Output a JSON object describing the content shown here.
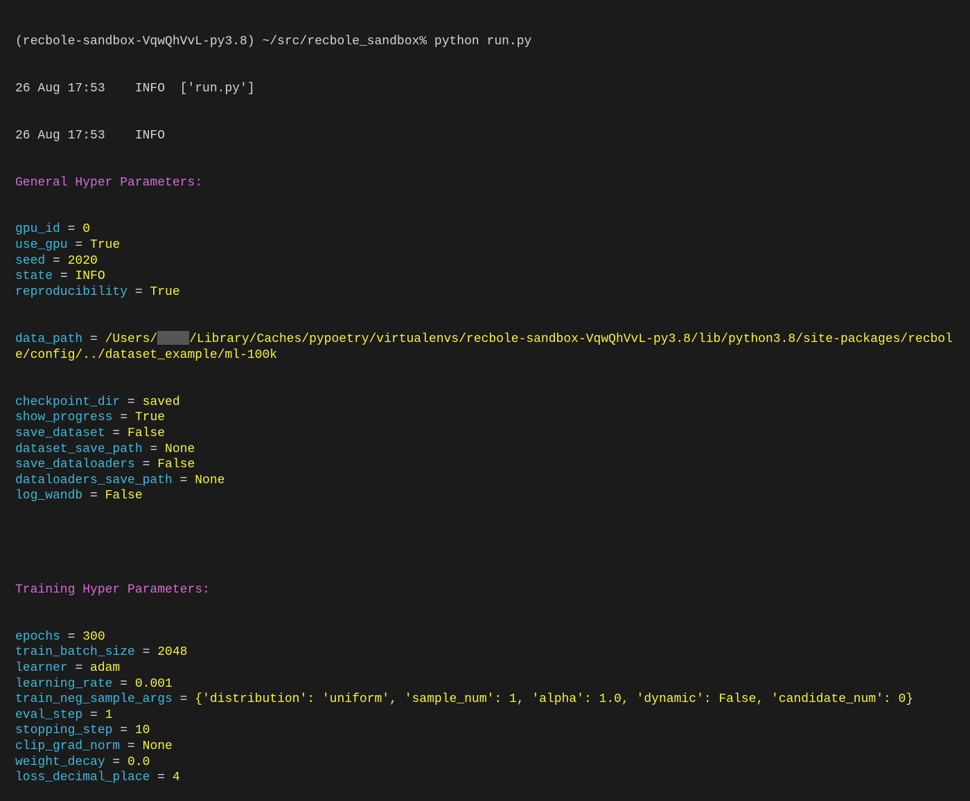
{
  "prompt": "(recbole-sandbox-VqwQhVvL-py3.8) ~/src/recbole_sandbox% python run.py",
  "log_lines": [
    "26 Aug 17:53    INFO  ['run.py']",
    "26 Aug 17:53    INFO"
  ],
  "general": {
    "heading": "General Hyper Parameters:",
    "params": [
      {
        "key": "gpu_id",
        "value": "0"
      },
      {
        "key": "use_gpu",
        "value": "True"
      },
      {
        "key": "seed",
        "value": "2020"
      },
      {
        "key": "state",
        "value": "INFO"
      },
      {
        "key": "reproducibility",
        "value": "True"
      }
    ],
    "data_path": {
      "key": "data_path",
      "prefix": "/Users/",
      "suffix": "/Library/Caches/pypoetry/virtualenvs/recbole-sandbox-VqwQhVvL-py3.8/lib/python3.8/site-packages/recbole/config/../dataset_example/ml-100k"
    },
    "params2": [
      {
        "key": "checkpoint_dir",
        "value": "saved"
      },
      {
        "key": "show_progress",
        "value": "True"
      },
      {
        "key": "save_dataset",
        "value": "False"
      },
      {
        "key": "dataset_save_path",
        "value": "None"
      },
      {
        "key": "save_dataloaders",
        "value": "False"
      },
      {
        "key": "dataloaders_save_path",
        "value": "None"
      },
      {
        "key": "log_wandb",
        "value": "False"
      }
    ]
  },
  "training": {
    "heading": "Training Hyper Parameters:",
    "params": [
      {
        "key": "epochs",
        "value": "300"
      },
      {
        "key": "train_batch_size",
        "value": "2048"
      },
      {
        "key": "learner",
        "value": "adam"
      },
      {
        "key": "learning_rate",
        "value": "0.001"
      },
      {
        "key": "train_neg_sample_args",
        "value": "{'distribution': 'uniform', 'sample_num': 1, 'alpha': 1.0, 'dynamic': False, 'candidate_num': 0}"
      },
      {
        "key": "eval_step",
        "value": "1"
      },
      {
        "key": "stopping_step",
        "value": "10"
      },
      {
        "key": "clip_grad_norm",
        "value": "None"
      },
      {
        "key": "weight_decay",
        "value": "0.0"
      },
      {
        "key": "loss_decimal_place",
        "value": "4"
      }
    ]
  },
  "colors": {
    "background": "#1b1b1b",
    "key": "#3cb8da",
    "value": "#f4f23c",
    "heading": "#d46ad8",
    "text": "#d4d4d4"
  }
}
